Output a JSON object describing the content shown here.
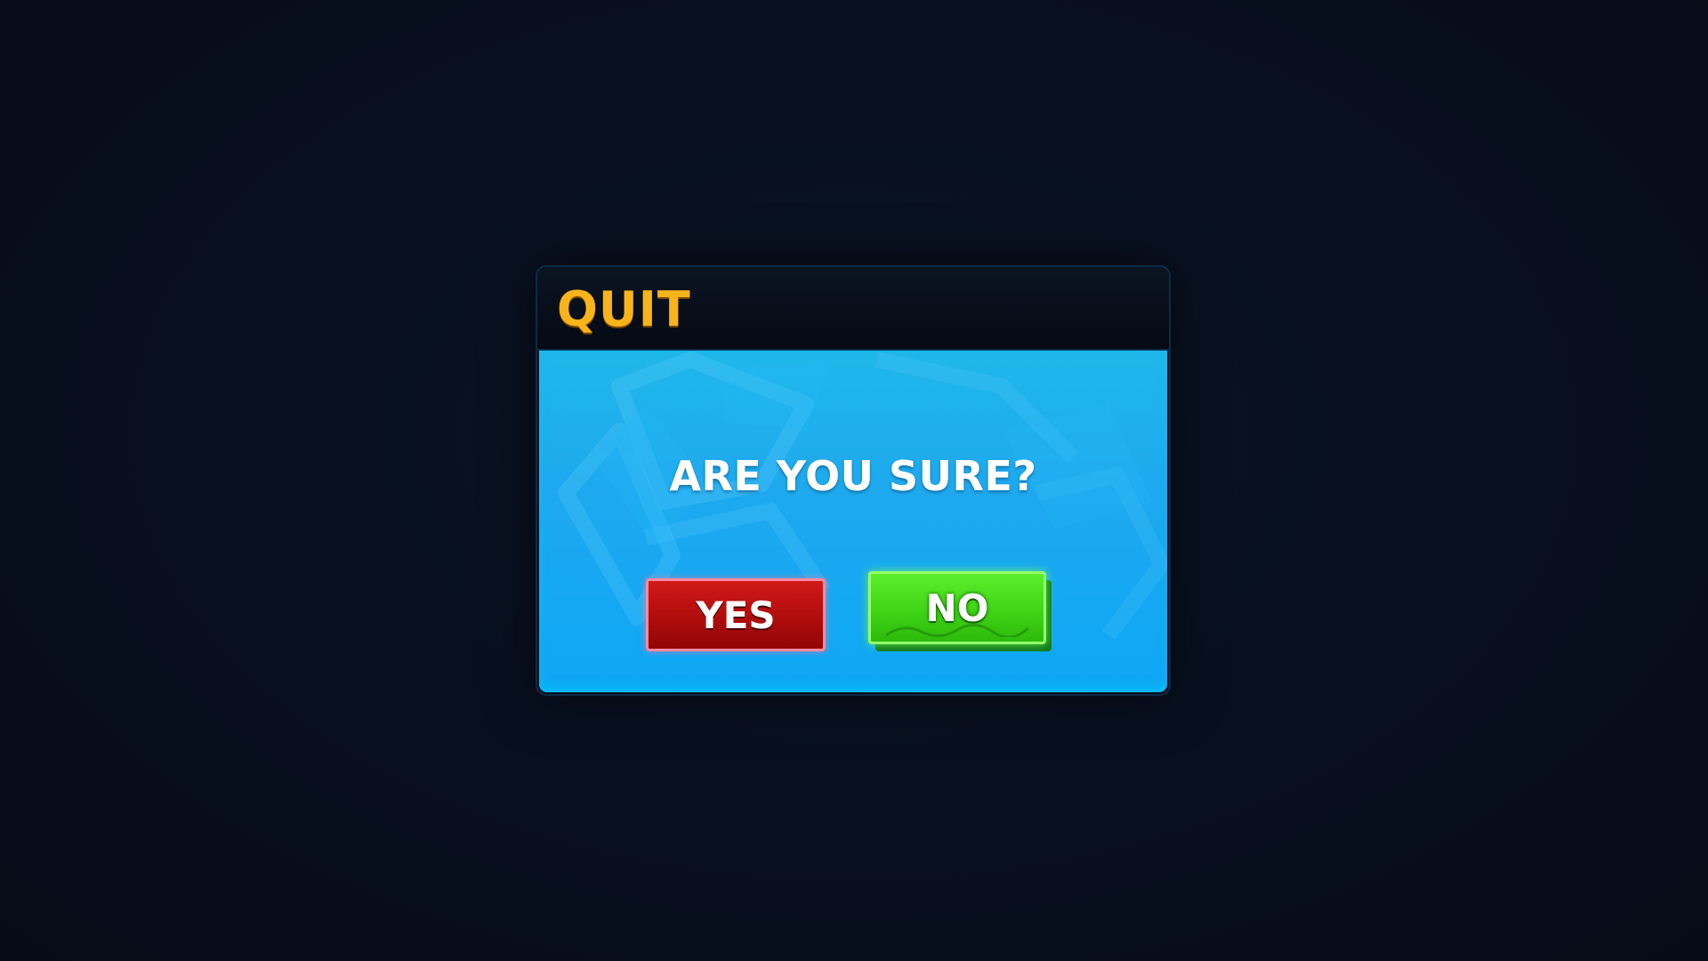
{
  "dialog": {
    "title": "QUIT",
    "question": "ARE YOU SURE?",
    "yes_label": "YES",
    "no_label": "NO"
  },
  "colors": {
    "title": "#f9b31b",
    "body": "#1ea9ee",
    "yes_button": "#c0111a",
    "no_button": "#3fd416",
    "background": "#070d1a"
  }
}
